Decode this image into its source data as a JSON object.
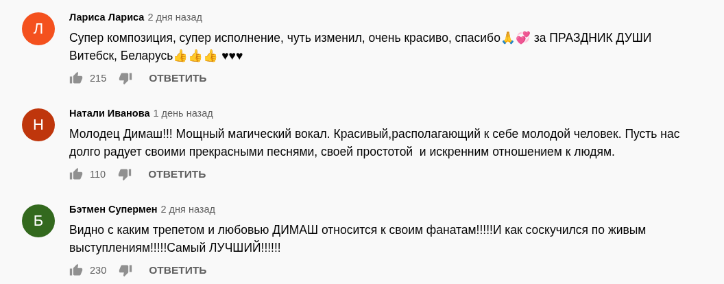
{
  "comments": [
    {
      "avatar_letter": "Л",
      "color": "#f4511e",
      "author": "Лариса Лариса",
      "time": "2 дня назад",
      "lines": [
        "Супер композиция, супер исполнение, чуть изменил, очень красиво, спасибо🙏💞 за ПРАЗДНИК ДУШИ",
        "Витебск, Беларусь👍👍👍 ♥♥♥"
      ],
      "likes": "215",
      "reply": "ОТВЕТИТЬ"
    },
    {
      "avatar_letter": "Н",
      "color": "#bf360c",
      "author": "Натали Иванова",
      "time": "1 день назад",
      "lines": [
        "Молодец Димаш!!! Мощный магический вокал. Красивый,располагающий к себе молодой человек. Пусть нас",
        "долго радует своими прекрасными песнями, своей простотой  и искренним отношением к людям."
      ],
      "likes": "110",
      "reply": "ОТВЕТИТЬ"
    },
    {
      "avatar_letter": "Б",
      "color": "#33691e",
      "author": "Бэтмен Супермен",
      "time": "2 дня назад",
      "lines": [
        "Видно с каким трепетом и любовью ДИМАШ относится к своим фанатам!!!!!И как соскучился по живым",
        "выступлениям!!!!!Самый ЛУЧШИЙ!!!!!!"
      ],
      "likes": "230",
      "reply": "ОТВЕТИТЬ"
    }
  ]
}
